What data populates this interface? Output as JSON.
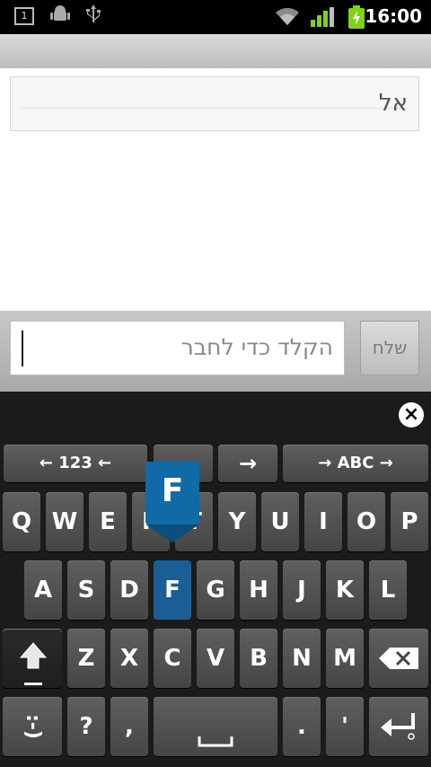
{
  "status_bar": {
    "notification_count": "1",
    "time": "16:00",
    "icons": [
      "notification-icon",
      "android-debug-icon",
      "usb-icon",
      "wifi-icon",
      "signal-icon",
      "battery-icon"
    ],
    "battery_color": "#7fd11b"
  },
  "message": {
    "text": "אל"
  },
  "composer": {
    "placeholder": "הקלד כדי לחבר",
    "send_label": "שלח"
  },
  "keyboard": {
    "pressed_key": "F",
    "pressed_color": "#1b5e96",
    "preview_letter": "F",
    "nav_row": {
      "left": "← 123 ←",
      "right": "→ ABC →",
      "arrow": "→"
    },
    "row1": [
      "Q",
      "W",
      "E",
      "R",
      "T",
      "Y",
      "U",
      "I",
      "O",
      "P"
    ],
    "row2": [
      "A",
      "S",
      "D",
      "F",
      "G",
      "H",
      "J",
      "K",
      "L"
    ],
    "row3": [
      "Z",
      "X",
      "C",
      "V",
      "B",
      "N",
      "M"
    ],
    "bottom": {
      "smiley": ":-)",
      "question": "?",
      "comma": ",",
      "period": ".",
      "apostrophe": "'"
    },
    "icons": [
      "close-icon",
      "shift-icon",
      "backspace-icon",
      "space-icon",
      "enter-icon"
    ]
  }
}
